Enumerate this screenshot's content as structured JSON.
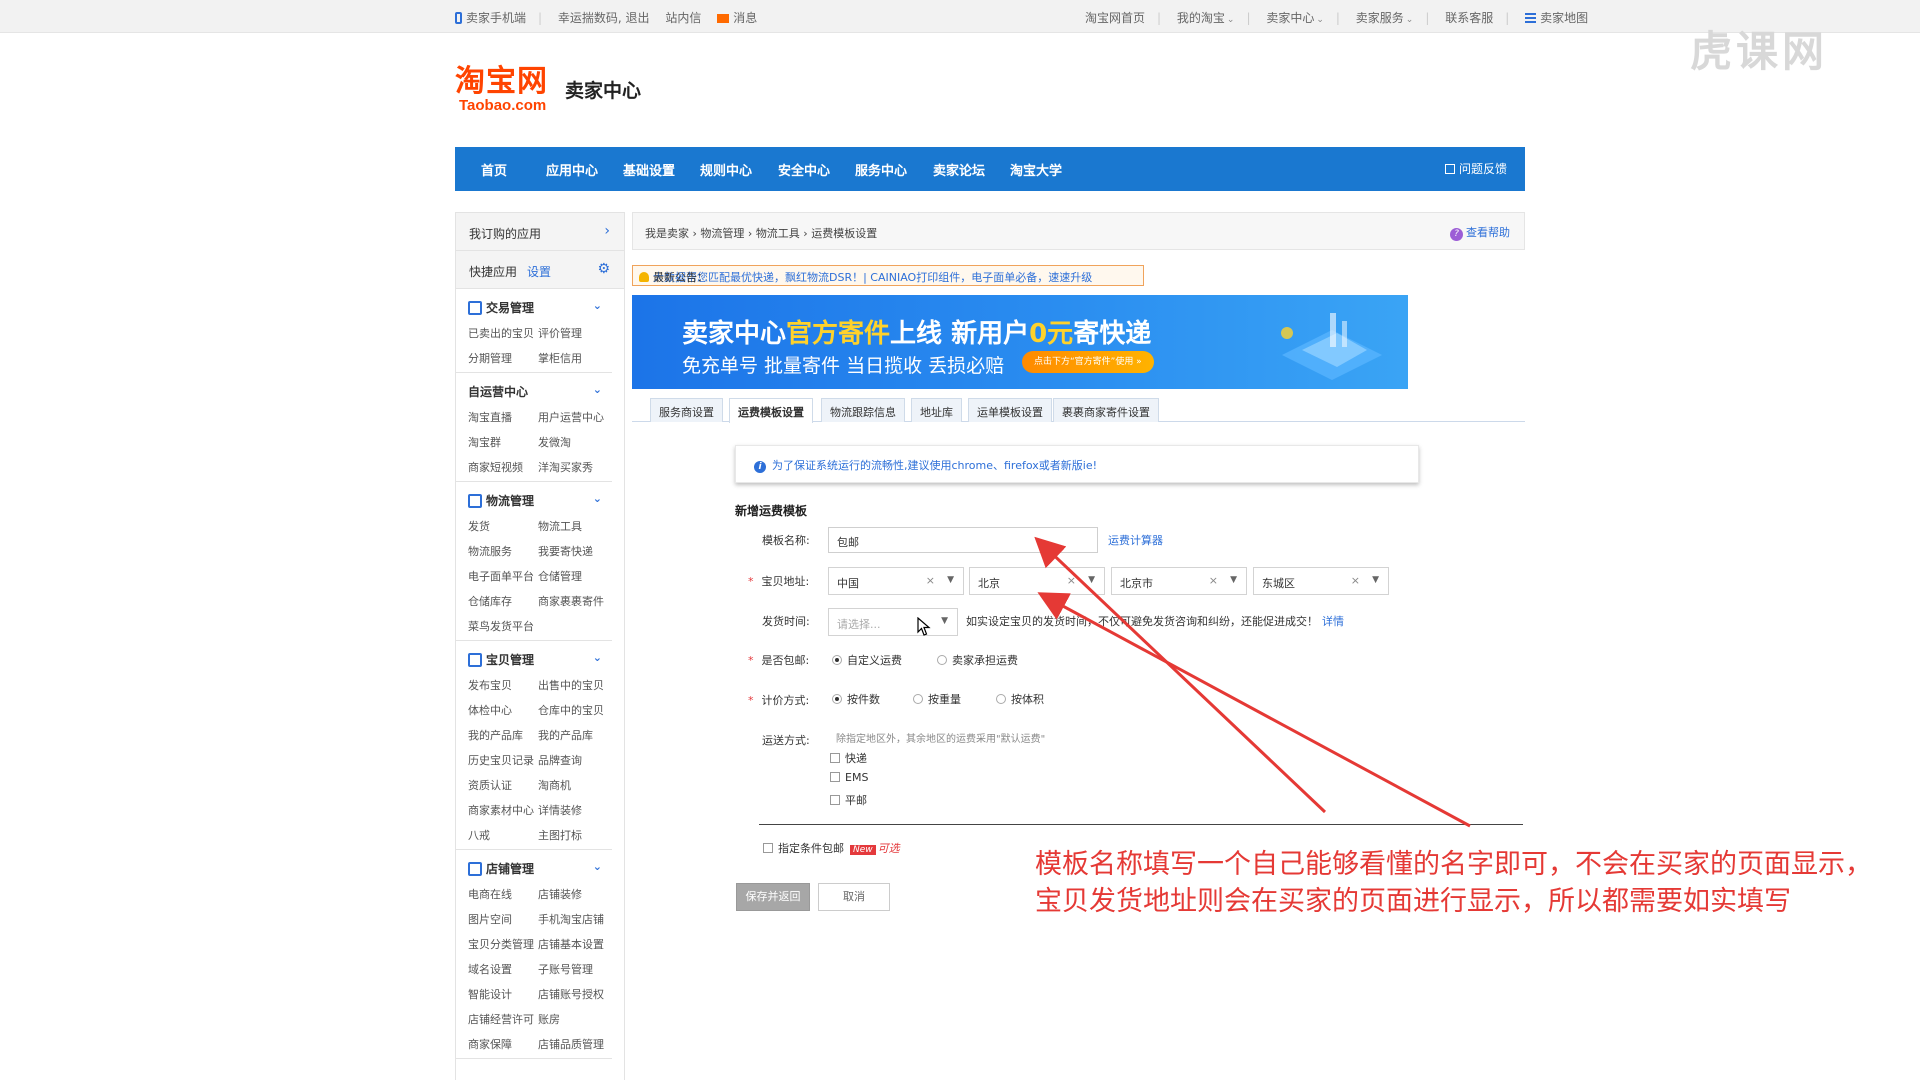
{
  "topbar": {
    "left": [
      "卖家手机端",
      "幸运揣数码, 退出",
      "站内信",
      "消息"
    ],
    "right": [
      "淘宝网首页",
      "我的淘宝",
      "卖家中心",
      "卖家服务",
      "联系客服",
      "卖家地图"
    ]
  },
  "logo": {
    "cn": "淘宝网",
    "en": "Taobao.com",
    "sub": "卖家中心"
  },
  "watermark": "虎课网",
  "nav": {
    "items": [
      "首页",
      "应用中心",
      "基础设置",
      "规则中心",
      "安全中心",
      "服务中心",
      "卖家论坛",
      "淘宝大学"
    ],
    "feedback": "问题反馈"
  },
  "sidebar": {
    "subscribed": "我订购的应用",
    "quick": "快捷应用",
    "quick_set": "设置",
    "sections": [
      {
        "title": "交易管理",
        "icon": "trade-icon",
        "items": [
          "已卖出的宝贝",
          "评价管理",
          "分期管理",
          "掌柜信用"
        ]
      },
      {
        "title": "自运营中心",
        "icon": "",
        "items": [
          "淘宝直播",
          "用户运营中心",
          "淘宝群",
          "发微淘",
          "商家短视频",
          "洋淘买家秀"
        ]
      },
      {
        "title": "物流管理",
        "icon": "truck-icon",
        "items": [
          "发货",
          "物流工具",
          "物流服务",
          "我要寄快递",
          "电子面单平台",
          "仓储管理",
          "仓储库存",
          "商家裹裹寄件",
          "菜鸟发货平台"
        ]
      },
      {
        "title": "宝贝管理",
        "icon": "shirt-icon",
        "items": [
          "发布宝贝",
          "出售中的宝贝",
          "体检中心",
          "仓库中的宝贝",
          "我的产品库",
          "我的产品库",
          "历史宝贝记录",
          "品牌查询",
          "资质认证",
          "淘商机",
          "商家素材中心",
          "详情装修",
          "八戒",
          "主图打标"
        ]
      },
      {
        "title": "店铺管理",
        "icon": "shop-icon",
        "items": [
          "电商在线",
          "店铺装修",
          "图片空间",
          "手机淘宝店铺",
          "宝贝分类管理",
          "店铺基本设置",
          "域名设置",
          "子账号管理",
          "智能设计",
          "店铺账号授权",
          "店铺经营许可",
          "账房",
          "商家保障",
          "店铺品质管理"
        ]
      }
    ]
  },
  "breadcrumb": [
    "我是卖家",
    "物流管理",
    "物流工具",
    "运费模板设置"
  ],
  "help": "查看帮助",
  "notice": {
    "label": "最新公告：",
    "text": "大数据帮您匹配最优快递，飘红物流DSR！| CAINIAO打印组件，电子面单必备，速速升级"
  },
  "banner": {
    "line1_a": "卖家中心",
    "line1_b": "官方寄件",
    "line1_c": "上线  新用户",
    "line1_d": "0元",
    "line1_e": "寄快递",
    "line2": "免充单号 批量寄件 当日揽收 丢损必赔",
    "button": "点击下方“官方寄件”使用 »"
  },
  "tabs": [
    "服务商设置",
    "运费模板设置",
    "物流跟踪信息",
    "地址库",
    "运单模板设置",
    "裹裹商家寄件设置"
  ],
  "active_tab": 1,
  "info_tip": "为了保证系统运行的流畅性,建议使用chrome、firefox或者新版ie!",
  "form": {
    "title": "新增运费模板",
    "name_label": "模板名称:",
    "name_value": "包邮",
    "calc_link": "运费计算器",
    "address_label": "宝贝地址:",
    "address": [
      "中国",
      "北京",
      "北京市",
      "东城区"
    ],
    "ship_time_label": "发货时间:",
    "ship_time_placeholder": "请选择...",
    "ship_time_hint": "如实设定宝贝的发货时间，不仅可避免发货咨询和纠纷，还能促进成交！",
    "ship_time_link": "详情",
    "free_label": "是否包邮:",
    "free_options": [
      "自定义运费",
      "卖家承担运费"
    ],
    "free_selected": 0,
    "pricing_label": "计价方式:",
    "pricing_options": [
      "按件数",
      "按重量",
      "按体积"
    ],
    "pricing_selected": 0,
    "method_label": "运送方式:",
    "method_note": "除指定地区外，其余地区的运费采用\"默认运费\"",
    "methods": [
      "快递",
      "EMS",
      "平邮"
    ],
    "conditional": "指定条件包邮",
    "new_badge": "New",
    "optional": "可选",
    "save": "保存并返回",
    "cancel": "取消"
  },
  "annotation": {
    "line1": "模板名称填写一个自己能够看懂的名字即可，不会在买家的页面显示，",
    "line2": "宝贝发货地址则会在买家的页面进行显示，所以都需要如实填写"
  },
  "colors": {
    "nav": "#1a78d0",
    "brand": "#ff4400",
    "annotation": "#e53935",
    "link": "#2d6fd8"
  }
}
